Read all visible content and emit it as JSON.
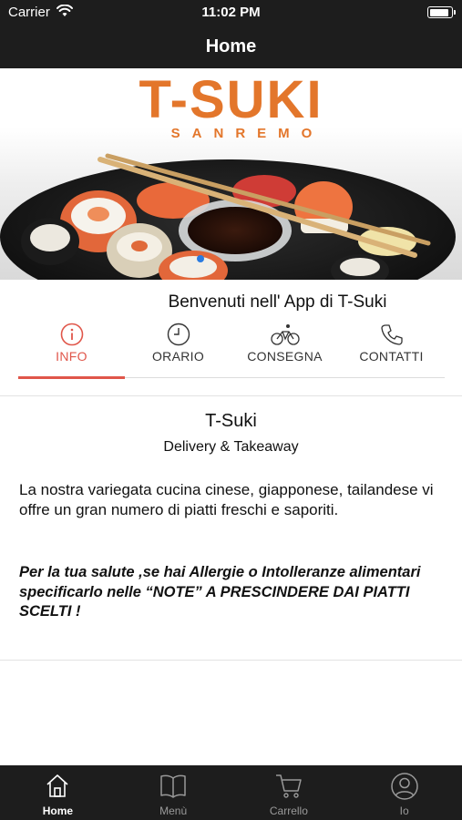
{
  "status_bar": {
    "carrier": "Carrier",
    "time": "11:02 PM"
  },
  "nav": {
    "title": "Home"
  },
  "hero": {
    "brand": "T-SUKI",
    "brand_sub": "SANREMO"
  },
  "welcome": "Benvenuti nell' App di T-Suki",
  "tabs": [
    {
      "label": "INFO",
      "icon": "info-icon",
      "active": true
    },
    {
      "label": "ORARIO",
      "icon": "clock-icon",
      "active": false
    },
    {
      "label": "CONSEGNA",
      "icon": "bicycle-icon",
      "active": false
    },
    {
      "label": "CONTATTI",
      "icon": "phone-icon",
      "active": false
    }
  ],
  "info": {
    "title": "T-Suki",
    "subtitle": "Delivery & Takeaway",
    "description": "La nostra variegata cucina cinese, giapponese, tailandese vi offre un gran numero di piatti freschi e saporiti.",
    "notice": "Per la tua salute ,se hai Allergie o Intolleranze alimentari specificarlo nelle “NOTE” A PRESCINDERE DAI PIATTI SCELTI !"
  },
  "tabbar": [
    {
      "label": "Home",
      "icon": "home-icon",
      "active": true
    },
    {
      "label": "Menù",
      "icon": "book-icon",
      "active": false
    },
    {
      "label": "Carrello",
      "icon": "cart-icon",
      "active": false
    },
    {
      "label": "Io",
      "icon": "user-icon",
      "active": false
    }
  ],
  "colors": {
    "accent": "#e0564a",
    "brand": "#e3762b",
    "bar": "#1d1d1d"
  }
}
